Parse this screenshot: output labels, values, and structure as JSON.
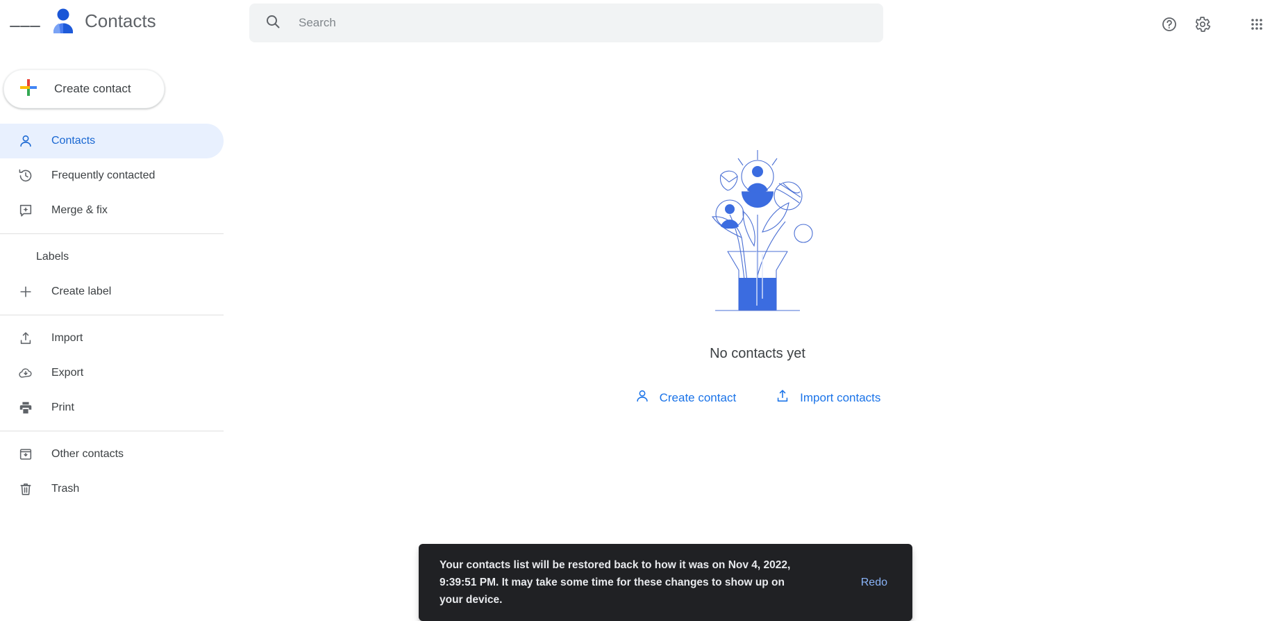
{
  "app": {
    "title": "Contacts",
    "logo_icon": "contacts-person-logo",
    "menu_icon": "hamburger-menu-icon"
  },
  "search": {
    "placeholder": "Search",
    "value": "",
    "icon": "search-icon"
  },
  "topbar_actions": [
    {
      "name": "help",
      "icon": "help-circle-icon",
      "label": "Support"
    },
    {
      "name": "settings",
      "icon": "gear-icon",
      "label": "Settings"
    },
    {
      "name": "apps",
      "icon": "apps-grid-icon",
      "label": "Google apps"
    }
  ],
  "sidebar": {
    "create_button": {
      "label": "Create contact",
      "icon": "google-plus-icon"
    },
    "items": [
      {
        "label": "Contacts",
        "icon": "person-outline-icon",
        "active": true
      },
      {
        "label": "Frequently contacted",
        "icon": "history-clock-icon",
        "active": false
      },
      {
        "label": "Merge & fix",
        "icon": "merge-sparkle-icon",
        "active": false
      }
    ],
    "labels_section": {
      "title": "Labels",
      "collapse_icon": "chevron-up-icon",
      "create_label": {
        "label": "Create label",
        "icon": "plus-icon"
      }
    },
    "tools": [
      {
        "label": "Import",
        "icon": "import-upload-icon"
      },
      {
        "label": "Export",
        "icon": "export-cloud-download-icon"
      },
      {
        "label": "Print",
        "icon": "printer-icon"
      }
    ],
    "footer_items": [
      {
        "label": "Other contacts",
        "icon": "other-contacts-box-icon"
      },
      {
        "label": "Trash",
        "icon": "trash-icon"
      }
    ]
  },
  "main": {
    "empty_state": {
      "illustration": "vase-of-contact-flowers-illustration",
      "title": "No contacts yet",
      "actions": [
        {
          "label": "Create contact",
          "icon": "person-outline-icon"
        },
        {
          "label": "Import contacts",
          "icon": "import-upload-icon"
        }
      ]
    }
  },
  "snackbar": {
    "message": "Your contacts list will be restored back to how it was on Nov 4, 2022, 9:39:51 PM. It may take some time for these changes to show up on your device.",
    "action_label": "Redo"
  },
  "colors": {
    "accent_blue": "#1a73e8",
    "active_nav_bg": "#e8f0fe",
    "active_nav_fg": "#1967d2",
    "text_primary": "#3c4043",
    "text_secondary": "#5f6368",
    "search_bg": "#f1f3f4",
    "snackbar_bg": "#202124",
    "snackbar_action": "#8ab4f8",
    "google_red": "#ea4335",
    "google_yellow": "#fbbc04",
    "google_green": "#34a853",
    "google_blue": "#4285f4"
  }
}
